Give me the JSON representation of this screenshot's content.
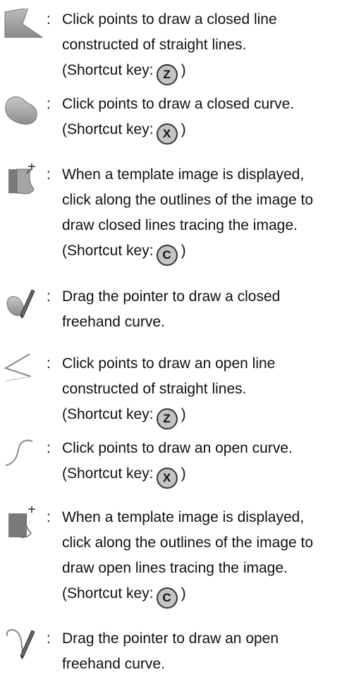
{
  "shortcut_prefix": "(Shortcut key:",
  "shortcut_suffix": ")",
  "items": [
    {
      "icon": "closed-polyline-icon",
      "lines": [
        "Click points to draw a closed line",
        "constructed of straight lines."
      ],
      "key": "Z"
    },
    {
      "icon": "closed-curve-icon",
      "lines": [
        "Click points to draw a closed curve."
      ],
      "key": "X"
    },
    {
      "icon": "closed-trace-icon",
      "lines": [
        "When a template image is displayed,",
        "click along the outlines of the image to",
        "draw closed lines tracing the image."
      ],
      "key": "C"
    },
    {
      "icon": "closed-freehand-icon",
      "lines": [
        "Drag the pointer to draw a closed",
        "freehand curve."
      ]
    },
    {
      "icon": "open-polyline-icon",
      "lines": [
        "Click points to draw an open line",
        "constructed of straight lines."
      ],
      "key": "Z"
    },
    {
      "icon": "open-curve-icon",
      "lines": [
        "Click points to draw an open curve."
      ],
      "key": "X"
    },
    {
      "icon": "open-trace-icon",
      "lines": [
        "When a template image is displayed,",
        "click along the outlines of the image to",
        "draw open lines tracing the image."
      ],
      "key": "C"
    },
    {
      "icon": "open-freehand-icon",
      "lines": [
        "Drag the pointer to draw an open",
        "freehand curve."
      ]
    }
  ]
}
